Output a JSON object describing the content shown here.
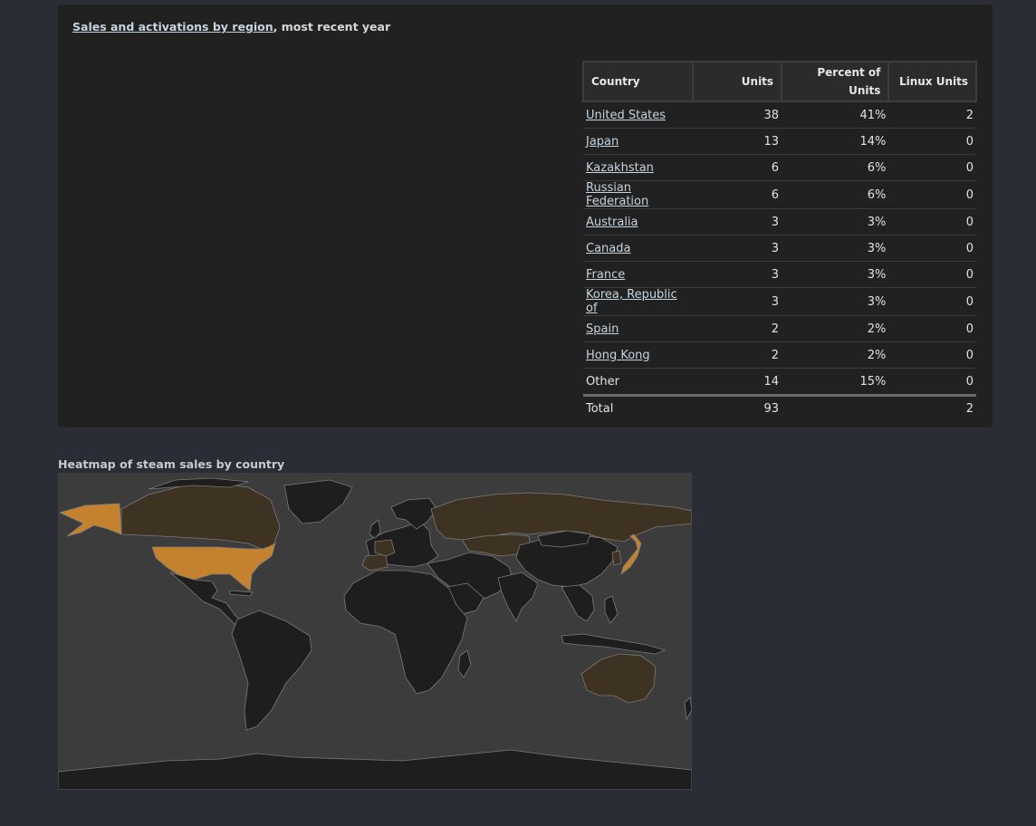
{
  "sales_panel": {
    "title_link": "Sales and activations by region",
    "title_suffix": ", most recent year",
    "table": {
      "headers": {
        "country": "Country",
        "units": "Units",
        "percent": "Percent of Units",
        "linux": "Linux Units"
      },
      "rows": [
        {
          "country": "United States",
          "units": "38",
          "percent": "41%",
          "linux": "2",
          "link": true
        },
        {
          "country": "Japan",
          "units": "13",
          "percent": "14%",
          "linux": "0",
          "link": true
        },
        {
          "country": "Kazakhstan",
          "units": "6",
          "percent": "6%",
          "linux": "0",
          "link": true
        },
        {
          "country": "Russian Federation",
          "units": "6",
          "percent": "6%",
          "linux": "0",
          "link": true
        },
        {
          "country": "Australia",
          "units": "3",
          "percent": "3%",
          "linux": "0",
          "link": true
        },
        {
          "country": "Canada",
          "units": "3",
          "percent": "3%",
          "linux": "0",
          "link": true
        },
        {
          "country": "France",
          "units": "3",
          "percent": "3%",
          "linux": "0",
          "link": true
        },
        {
          "country": "Korea, Republic of",
          "units": "3",
          "percent": "3%",
          "linux": "0",
          "link": true
        },
        {
          "country": "Spain",
          "units": "2",
          "percent": "2%",
          "linux": "0",
          "link": true
        },
        {
          "country": "Hong Kong",
          "units": "2",
          "percent": "2%",
          "linux": "0",
          "link": true
        },
        {
          "country": "Other",
          "units": "14",
          "percent": "15%",
          "linux": "0",
          "link": false
        }
      ],
      "total": {
        "label": "Total",
        "units": "93",
        "percent": "",
        "linux": "2"
      }
    }
  },
  "heatmap": {
    "title": "Heatmap of steam sales by country",
    "colors": {
      "ocean": "#3c3c3c",
      "no_sales": "#1e1e1e",
      "high": "#c4822f",
      "low": "#3e3222"
    }
  }
}
